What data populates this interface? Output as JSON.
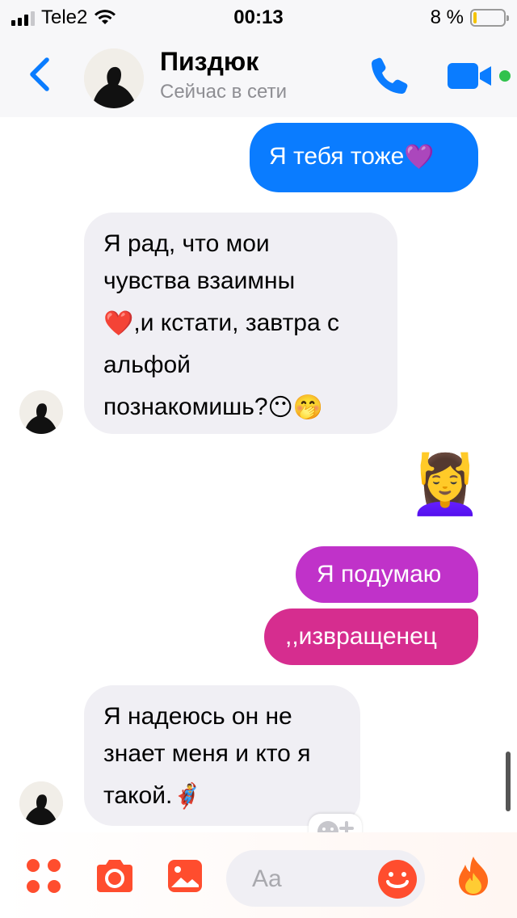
{
  "status_bar": {
    "carrier": "Tele2",
    "time": "00:13",
    "battery_percent": "8 %",
    "battery_level": 0.08
  },
  "header": {
    "contact_name": "Пиздюк",
    "contact_status": "Сейчас в сети",
    "online_color": "#31c24d",
    "accent_color": "#0a7cff"
  },
  "messages": [
    {
      "direction": "outgoing",
      "text": "Я тебя тоже",
      "emoji": "💜"
    },
    {
      "direction": "incoming",
      "lines": [
        "Я рад, что мои",
        "чувства взаимны",
        ",и кстати, завтра с",
        "альфой",
        "познакомишь?"
      ],
      "emoji": [
        "❤️",
        "😶",
        "🤭"
      ]
    },
    {
      "direction": "outgoing",
      "type": "emoji",
      "emoji": "💆‍♀️"
    },
    {
      "direction": "outgoing",
      "text": "Я подумаю"
    },
    {
      "direction": "outgoing",
      "text": ",,извращенец"
    },
    {
      "direction": "incoming",
      "lines": [
        "Я надеюсь он не",
        "знает меня и кто я",
        "такой."
      ],
      "emoji": [
        "🦸‍♂️"
      ]
    }
  ],
  "composer": {
    "placeholder": "Aa",
    "accent_color": "#ff4d2e"
  }
}
